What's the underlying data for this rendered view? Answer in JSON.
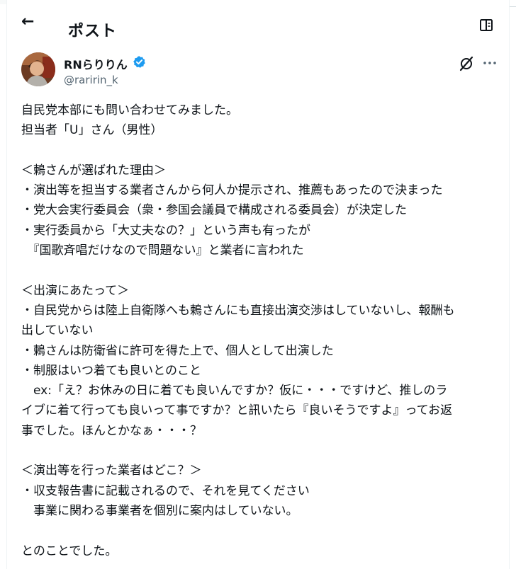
{
  "header": {
    "back_glyph": "←",
    "title": "ポスト"
  },
  "post": {
    "author": {
      "name": "RNらりりん",
      "handle": "@raririn_k",
      "verified_color": "#1d9bf0"
    },
    "body_lines": [
      "自民党本部にも問い合わせてみました。",
      "担当者「U」さん（男性）",
      "",
      "＜鶫さんが選ばれた理由＞",
      "・演出等を担当する業者さんから何人か提示され、推薦もあったので決まった",
      "・党大会実行委員会（衆・参国会議員で構成される委員会）が決定した",
      "・実行委員から「大丈夫なの？」という声も有ったが",
      "　『国歌斉唱だけなので問題ない』と業者に言われた",
      "",
      "＜出演にあたって＞",
      "・自民党からは陸上自衛隊へも鶫さんにも直接出演交渉はしていないし、報酬も",
      "出していない",
      "・鶫さんは防衛省に許可を得た上で、個人として出演した",
      "・制服はいつ着ても良いとのこと",
      "　ex:「え？お休みの日に着ても良いんですか？仮に・・・ですけど、推しのラ",
      "イブに着て行っても良いって事ですか？と訊いたら『良いそうですよ』ってお返",
      "事でした。ほんとかなぁ・・・？",
      "",
      "＜演出等を行った業者はどこ？＞",
      "・収支報告書に記載されるので、それを見てください",
      "　事業に関わる事業者を個別に案内はしていない。",
      "",
      "とのことでした。"
    ]
  },
  "icons": {
    "back": "arrow-left-icon",
    "reader": "reader-icon",
    "verified": "verified-badge-icon",
    "grok": "grok-icon",
    "more": "more-horizontal-icon"
  },
  "colors": {
    "text": "#0f1419",
    "secondary": "#536471",
    "accent": "#1d9bf0"
  }
}
